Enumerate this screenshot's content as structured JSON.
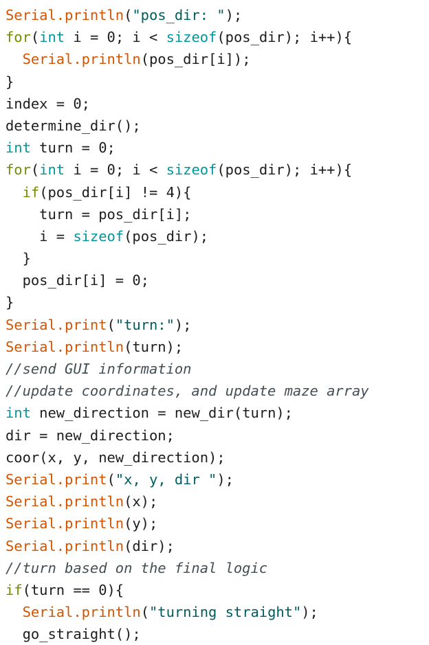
{
  "editor": {
    "language": "arduino-cpp",
    "background_color": "#ffffff",
    "theme_colors": {
      "function": "#d35400",
      "datatype_keyword": "#00979c",
      "structure_keyword": "#728e00",
      "string_literal": "#005c5f",
      "comment": "#434f54",
      "plain_text": "#1d1d1d"
    },
    "line_count": 28,
    "lines": [
      {
        "n": 1,
        "indent": 0,
        "text": "Serial.println(\"pos_dir: \");",
        "tokens": [
          {
            "t": "Serial.println",
            "c": "func"
          },
          {
            "t": "(",
            "c": "punct"
          },
          {
            "t": "\"pos_dir: \"",
            "c": "string"
          },
          {
            "t": ");",
            "c": "punct"
          }
        ]
      },
      {
        "n": 2,
        "indent": 0,
        "text": "for(int i = 0; i < sizeof(pos_dir); i++){",
        "tokens": [
          {
            "t": "for",
            "c": "struct"
          },
          {
            "t": "(",
            "c": "punct"
          },
          {
            "t": "int",
            "c": "keyword"
          },
          {
            "t": " i = 0; i < ",
            "c": "plain"
          },
          {
            "t": "sizeof",
            "c": "keyword"
          },
          {
            "t": "(pos_dir); i++){",
            "c": "plain"
          }
        ]
      },
      {
        "n": 3,
        "indent": 1,
        "text": "Serial.println(pos_dir[i]);",
        "tokens": [
          {
            "t": "Serial.println",
            "c": "func"
          },
          {
            "t": "(pos_dir[i]);",
            "c": "plain"
          }
        ]
      },
      {
        "n": 4,
        "indent": 0,
        "text": "}",
        "tokens": [
          {
            "t": "}",
            "c": "plain"
          }
        ]
      },
      {
        "n": 5,
        "indent": 0,
        "text": "index = 0;",
        "tokens": [
          {
            "t": "index = 0;",
            "c": "plain"
          }
        ]
      },
      {
        "n": 6,
        "indent": 0,
        "text": "determine_dir();",
        "tokens": [
          {
            "t": "determine_dir();",
            "c": "plain"
          }
        ]
      },
      {
        "n": 7,
        "indent": 0,
        "text": "int turn = 0;",
        "tokens": [
          {
            "t": "int",
            "c": "keyword"
          },
          {
            "t": " turn = 0;",
            "c": "plain"
          }
        ]
      },
      {
        "n": 8,
        "indent": 0,
        "text": "for(int i = 0; i < sizeof(pos_dir); i++){",
        "tokens": [
          {
            "t": "for",
            "c": "struct"
          },
          {
            "t": "(",
            "c": "punct"
          },
          {
            "t": "int",
            "c": "keyword"
          },
          {
            "t": " i = 0; i < ",
            "c": "plain"
          },
          {
            "t": "sizeof",
            "c": "keyword"
          },
          {
            "t": "(pos_dir); i++){",
            "c": "plain"
          }
        ]
      },
      {
        "n": 9,
        "indent": 1,
        "text": "if(pos_dir[i] != 4){",
        "tokens": [
          {
            "t": "if",
            "c": "struct"
          },
          {
            "t": "(pos_dir[i] != 4){",
            "c": "plain"
          }
        ]
      },
      {
        "n": 10,
        "indent": 2,
        "text": "turn = pos_dir[i];",
        "tokens": [
          {
            "t": "turn = pos_dir[i];",
            "c": "plain"
          }
        ]
      },
      {
        "n": 11,
        "indent": 2,
        "text": "i = sizeof(pos_dir);",
        "tokens": [
          {
            "t": "i = ",
            "c": "plain"
          },
          {
            "t": "sizeof",
            "c": "keyword"
          },
          {
            "t": "(pos_dir);",
            "c": "plain"
          }
        ]
      },
      {
        "n": 12,
        "indent": 1,
        "text": "}",
        "tokens": [
          {
            "t": "}",
            "c": "plain"
          }
        ]
      },
      {
        "n": 13,
        "indent": 1,
        "text": "pos_dir[i] = 0;",
        "tokens": [
          {
            "t": "pos_dir[i] = 0;",
            "c": "plain"
          }
        ]
      },
      {
        "n": 14,
        "indent": 0,
        "text": "}",
        "tokens": [
          {
            "t": "}",
            "c": "plain"
          }
        ]
      },
      {
        "n": 15,
        "indent": 0,
        "text": "Serial.print(\"turn:\");",
        "tokens": [
          {
            "t": "Serial.print",
            "c": "func"
          },
          {
            "t": "(",
            "c": "punct"
          },
          {
            "t": "\"turn:\"",
            "c": "string"
          },
          {
            "t": ");",
            "c": "punct"
          }
        ]
      },
      {
        "n": 16,
        "indent": 0,
        "text": "Serial.println(turn);",
        "tokens": [
          {
            "t": "Serial.println",
            "c": "func"
          },
          {
            "t": "(turn);",
            "c": "plain"
          }
        ]
      },
      {
        "n": 17,
        "indent": 0,
        "text": "//send GUI information",
        "tokens": [
          {
            "t": "//send GUI information",
            "c": "comment"
          }
        ]
      },
      {
        "n": 18,
        "indent": 0,
        "text": "//update coordinates, and update maze array",
        "tokens": [
          {
            "t": "//update coordinates, and update maze array",
            "c": "comment"
          }
        ]
      },
      {
        "n": 19,
        "indent": 0,
        "text": "int new_direction = new_dir(turn);",
        "tokens": [
          {
            "t": "int",
            "c": "keyword"
          },
          {
            "t": " new_direction = new_dir(turn);",
            "c": "plain"
          }
        ]
      },
      {
        "n": 20,
        "indent": 0,
        "text": "dir = new_direction;",
        "tokens": [
          {
            "t": "dir = new_direction;",
            "c": "plain"
          }
        ]
      },
      {
        "n": 21,
        "indent": 0,
        "text": "coor(x, y, new_direction);",
        "tokens": [
          {
            "t": "coor(x, y, new_direction);",
            "c": "plain"
          }
        ]
      },
      {
        "n": 22,
        "indent": 0,
        "text": "Serial.print(\"x, y, dir \");",
        "tokens": [
          {
            "t": "Serial.print",
            "c": "func"
          },
          {
            "t": "(",
            "c": "punct"
          },
          {
            "t": "\"x, y, dir \"",
            "c": "string"
          },
          {
            "t": ");",
            "c": "punct"
          }
        ]
      },
      {
        "n": 23,
        "indent": 0,
        "text": "Serial.println(x);",
        "tokens": [
          {
            "t": "Serial.println",
            "c": "func"
          },
          {
            "t": "(x);",
            "c": "plain"
          }
        ]
      },
      {
        "n": 24,
        "indent": 0,
        "text": "Serial.println(y);",
        "tokens": [
          {
            "t": "Serial.println",
            "c": "func"
          },
          {
            "t": "(y);",
            "c": "plain"
          }
        ]
      },
      {
        "n": 25,
        "indent": 0,
        "text": "Serial.println(dir);",
        "tokens": [
          {
            "t": "Serial.println",
            "c": "func"
          },
          {
            "t": "(dir);",
            "c": "plain"
          }
        ]
      },
      {
        "n": 26,
        "indent": 0,
        "text": "//turn based on the final logic",
        "tokens": [
          {
            "t": "//turn based on the final logic",
            "c": "comment"
          }
        ]
      },
      {
        "n": 27,
        "indent": 0,
        "text": "if(turn == 0){",
        "tokens": [
          {
            "t": "if",
            "c": "struct"
          },
          {
            "t": "(turn == 0){",
            "c": "plain"
          }
        ]
      },
      {
        "n": 28,
        "indent": 1,
        "text": "Serial.println(\"turning straight\");",
        "tokens": [
          {
            "t": "Serial.println",
            "c": "func"
          },
          {
            "t": "(",
            "c": "punct"
          },
          {
            "t": "\"turning straight\"",
            "c": "string"
          },
          {
            "t": ");",
            "c": "punct"
          }
        ]
      },
      {
        "n": 29,
        "indent": 1,
        "text": "go_straight();",
        "tokens": [
          {
            "t": "go_straight();",
            "c": "plain"
          }
        ]
      }
    ]
  }
}
